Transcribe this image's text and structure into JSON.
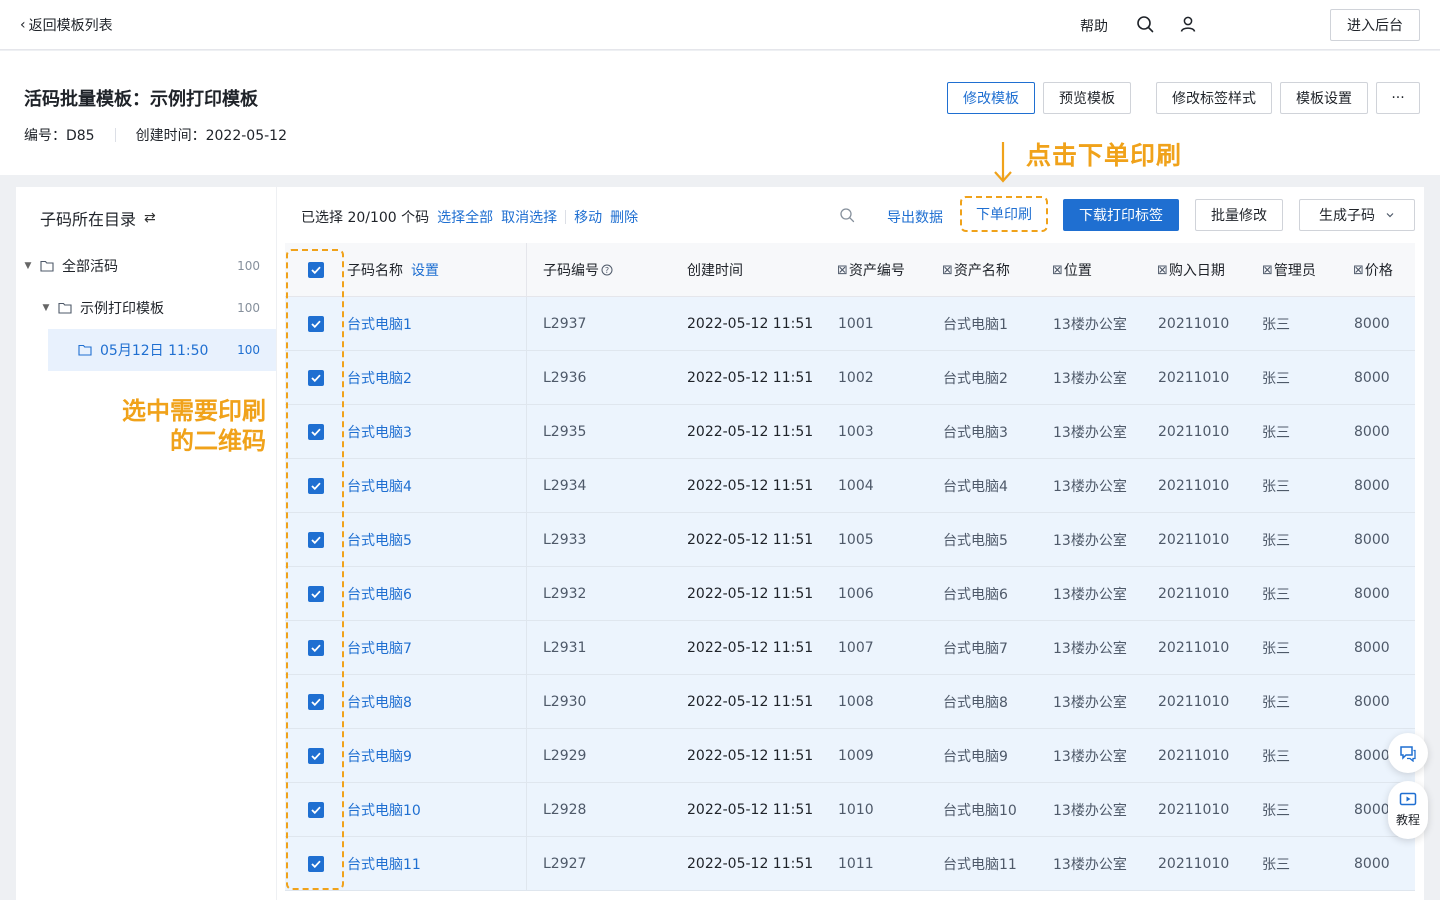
{
  "topbar": {
    "back_label": "返回模板列表",
    "help_label": "帮助",
    "admin_label": "进入后台"
  },
  "header": {
    "title": "活码批量模板：示例打印模板",
    "code_meta": "编号：D85",
    "created_meta": "创建时间：2022-05-12",
    "buttons": {
      "edit_template": "修改模板",
      "preview_template": "预览模板",
      "edit_label_style": "修改标签样式",
      "template_settings": "模板设置",
      "more": "···"
    }
  },
  "annotations": {
    "top": "点击下单印刷",
    "left_line1": "选中需要印刷",
    "left_line2": "的二维码",
    "accent_color": "#f0a21a"
  },
  "sidebar": {
    "title": "子码所在目录",
    "swap_icon": "⇄",
    "items": [
      {
        "label": "全部活码",
        "count": "100"
      },
      {
        "label": "示例打印模板",
        "count": "100"
      },
      {
        "label": "05月12日 11:50",
        "count": "100"
      }
    ]
  },
  "toolbar": {
    "selected": "已选择 20/100 个码",
    "select_all": "选择全部",
    "deselect": "取消选择",
    "move": "移动",
    "delete": "删除",
    "export": "导出数据",
    "order_print": "下单印刷",
    "download_labels": "下载打印标签",
    "batch_edit": "批量修改",
    "generate": "生成子码"
  },
  "table": {
    "headers": {
      "name": "子码名称",
      "settings": "设置",
      "code": "子码编号",
      "created": "创建时间",
      "asset_no": "资产编号",
      "asset_name": "资产名称",
      "location": "位置",
      "purchase_date": "购入日期",
      "manager": "管理员",
      "price": "价格"
    },
    "rows": [
      {
        "name": "台式电脑1",
        "code": "L2937",
        "created": "2022-05-12 11:51",
        "asset_no": "1001",
        "asset_name": "台式电脑1",
        "location": "13楼办公室",
        "purchase_date": "20211010",
        "manager": "张三",
        "price": "8000"
      },
      {
        "name": "台式电脑2",
        "code": "L2936",
        "created": "2022-05-12 11:51",
        "asset_no": "1002",
        "asset_name": "台式电脑2",
        "location": "13楼办公室",
        "purchase_date": "20211010",
        "manager": "张三",
        "price": "8000"
      },
      {
        "name": "台式电脑3",
        "code": "L2935",
        "created": "2022-05-12 11:51",
        "asset_no": "1003",
        "asset_name": "台式电脑3",
        "location": "13楼办公室",
        "purchase_date": "20211010",
        "manager": "张三",
        "price": "8000"
      },
      {
        "name": "台式电脑4",
        "code": "L2934",
        "created": "2022-05-12 11:51",
        "asset_no": "1004",
        "asset_name": "台式电脑4",
        "location": "13楼办公室",
        "purchase_date": "20211010",
        "manager": "张三",
        "price": "8000"
      },
      {
        "name": "台式电脑5",
        "code": "L2933",
        "created": "2022-05-12 11:51",
        "asset_no": "1005",
        "asset_name": "台式电脑5",
        "location": "13楼办公室",
        "purchase_date": "20211010",
        "manager": "张三",
        "price": "8000"
      },
      {
        "name": "台式电脑6",
        "code": "L2932",
        "created": "2022-05-12 11:51",
        "asset_no": "1006",
        "asset_name": "台式电脑6",
        "location": "13楼办公室",
        "purchase_date": "20211010",
        "manager": "张三",
        "price": "8000"
      },
      {
        "name": "台式电脑7",
        "code": "L2931",
        "created": "2022-05-12 11:51",
        "asset_no": "1007",
        "asset_name": "台式电脑7",
        "location": "13楼办公室",
        "purchase_date": "20211010",
        "manager": "张三",
        "price": "8000"
      },
      {
        "name": "台式电脑8",
        "code": "L2930",
        "created": "2022-05-12 11:51",
        "asset_no": "1008",
        "asset_name": "台式电脑8",
        "location": "13楼办公室",
        "purchase_date": "20211010",
        "manager": "张三",
        "price": "8000"
      },
      {
        "name": "台式电脑9",
        "code": "L2929",
        "created": "2022-05-12 11:51",
        "asset_no": "1009",
        "asset_name": "台式电脑9",
        "location": "13楼办公室",
        "purchase_date": "20211010",
        "manager": "张三",
        "price": "8000"
      },
      {
        "name": "台式电脑10",
        "code": "L2928",
        "created": "2022-05-12 11:51",
        "asset_no": "1010",
        "asset_name": "台式电脑10",
        "location": "13楼办公室",
        "purchase_date": "20211010",
        "manager": "张三",
        "price": "8000"
      },
      {
        "name": "台式电脑11",
        "code": "L2927",
        "created": "2022-05-12 11:51",
        "asset_no": "1011",
        "asset_name": "台式电脑11",
        "location": "13楼办公室",
        "purchase_date": "20211010",
        "manager": "张三",
        "price": "8000"
      }
    ]
  },
  "float": {
    "tutorial_label": "教程"
  },
  "colors": {
    "primary": "#1f6fd1",
    "accent": "#f0a21a",
    "row_selected": "#ecf4fd"
  }
}
